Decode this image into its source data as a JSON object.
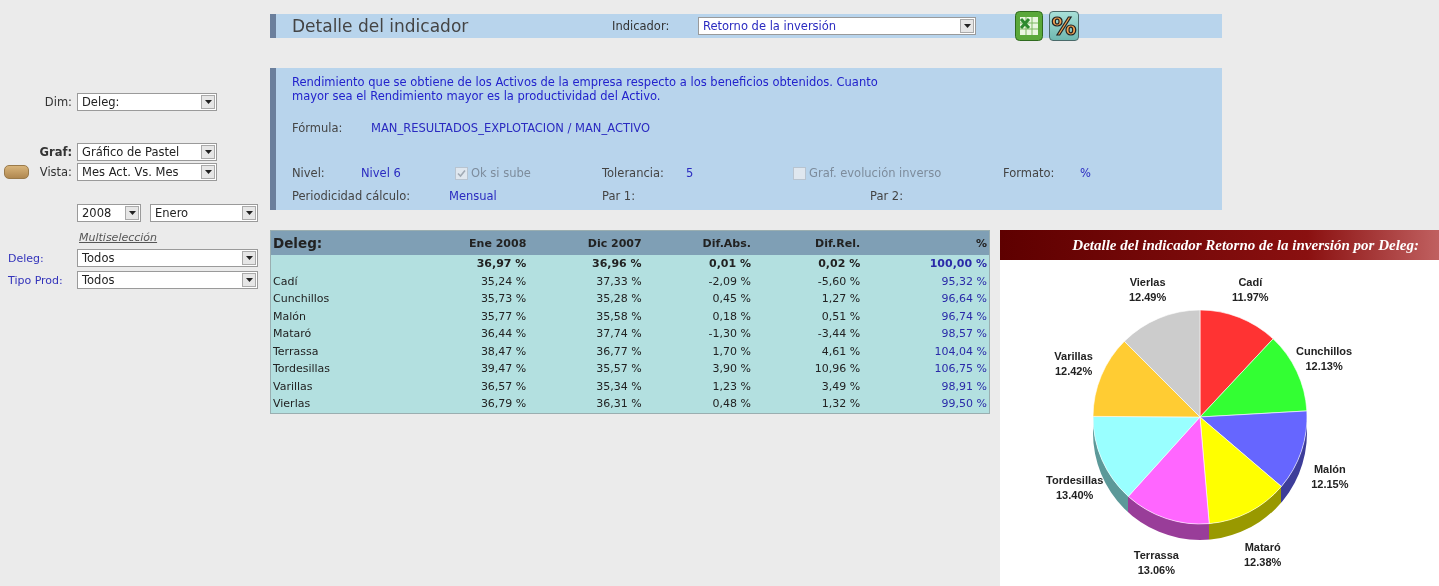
{
  "sidebar": {
    "dim": {
      "label": "Dim:",
      "value": "Deleg:"
    },
    "graf": {
      "label": "Graf:",
      "value": "Gráfico de Pastel"
    },
    "vista": {
      "label": "Vista:",
      "value": "Mes Act. Vs. Mes"
    },
    "year": "2008",
    "month": "Enero",
    "multiselect_link": "Multiselección",
    "filters": [
      {
        "label": "Deleg:",
        "value": "Todos"
      },
      {
        "label": "Tipo Prod:",
        "value": "Todos"
      }
    ]
  },
  "header": {
    "title": "Detalle del indicador",
    "indicator_label": "Indicador:",
    "indicator_value": "Retorno de la inversión",
    "percent_button": "%"
  },
  "info": {
    "description": "Rendimiento que se obtiene de los Activos de la empresa respecto a los beneficios obtenidos. Cuanto mayor sea el Rendimiento mayor es la productividad del Activo.",
    "formula_label": "Fórmula:",
    "formula": "MAN_RESULTADOS_EXPLOTACION / MAN_ACTIVO",
    "nivel_label": "Nivel:",
    "nivel": "Nivel 6",
    "ok_si_sube": {
      "label": "Ok si sube",
      "checked": true,
      "disabled": true
    },
    "tolerancia_label": "Tolerancia:",
    "tolerancia": "5",
    "graf_inverso": {
      "label": "Graf. evolución inverso",
      "checked": false,
      "disabled": true
    },
    "formato_label": "Formato:",
    "formato": "%",
    "periodicidad_label": "Periodicidad cálculo:",
    "periodicidad": "Mensual",
    "par1_label": "Par 1:",
    "par2_label": "Par 2:"
  },
  "table": {
    "columns": [
      "Deleg:",
      "Ene 2008",
      "Dic 2007",
      "Dif.Abs.",
      "Dif.Rel.",
      "%"
    ],
    "rows": [
      {
        "kind": "total",
        "values": [
          "36,97 %",
          "36,96 %",
          "0,01 %",
          "0,02 %",
          "100,00 %"
        ]
      },
      {
        "kind": "item",
        "name": "Cadí",
        "values": [
          "35,24 %",
          "37,33 %",
          "-2,09 %",
          "-5,60 %",
          "95,32 %"
        ]
      },
      {
        "kind": "item",
        "name": "Cunchillos",
        "values": [
          "35,73 %",
          "35,28 %",
          "0,45 %",
          "1,27 %",
          "96,64 %"
        ]
      },
      {
        "kind": "item",
        "name": "Malón",
        "values": [
          "35,77 %",
          "35,58 %",
          "0,18 %",
          "0,51 %",
          "96,74 %"
        ]
      },
      {
        "kind": "item",
        "name": "Mataró",
        "values": [
          "36,44 %",
          "37,74 %",
          "-1,30 %",
          "-3,44 %",
          "98,57 %"
        ]
      },
      {
        "kind": "item",
        "name": "Terrassa",
        "values": [
          "38,47 %",
          "36,77 %",
          "1,70 %",
          "4,61 %",
          "104,04 %"
        ]
      },
      {
        "kind": "item",
        "name": "Tordesillas",
        "values": [
          "39,47 %",
          "35,57 %",
          "3,90 %",
          "10,96 %",
          "106,75 %"
        ]
      },
      {
        "kind": "item",
        "name": "Varillas",
        "values": [
          "36,57 %",
          "35,34 %",
          "1,23 %",
          "3,49 %",
          "98,91 %"
        ]
      },
      {
        "kind": "item",
        "name": "Vierlas",
        "values": [
          "36,79 %",
          "36,31 %",
          "0,48 %",
          "1,32 %",
          "99,50 %"
        ]
      }
    ]
  },
  "chart": {
    "chart_data": {
      "type": "pie",
      "title": "Detalle del indicador Retorno de la inversión por Deleg:",
      "categories": [
        "Cadí",
        "Cunchillos",
        "Malón",
        "Mataró",
        "Terrassa",
        "Tordesillas",
        "Varillas",
        "Vierlas"
      ],
      "values": [
        11.97,
        12.13,
        12.15,
        12.38,
        13.06,
        13.4,
        12.42,
        12.49
      ],
      "value_labels": [
        "11.97%",
        "12.13%",
        "12.15%",
        "12.38%",
        "13.06%",
        "13.40%",
        "12.42%",
        "12.49%"
      ],
      "colors": [
        "#ff3333",
        "#33ff33",
        "#6666ff",
        "#ffff00",
        "#ff66ff",
        "#99ffff",
        "#ffcc33",
        "#cccccc"
      ]
    }
  }
}
